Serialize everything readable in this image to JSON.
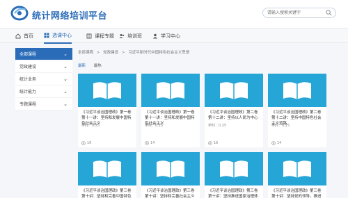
{
  "header": {
    "site_title": "统计网络培训平台",
    "search_placeholder": "请输入搜索关键字"
  },
  "nav": {
    "items": [
      {
        "label": "首页",
        "icon": "home-icon",
        "active": false
      },
      {
        "label": "选课中心",
        "icon": "grid-icon",
        "active": true
      },
      {
        "label": "课程专题",
        "icon": "book-icon",
        "active": false
      },
      {
        "label": "培训班",
        "icon": "users-icon",
        "active": false
      },
      {
        "label": "学习中心",
        "icon": "user-icon",
        "active": false
      }
    ]
  },
  "sidebar": {
    "items": [
      {
        "label": "全部课程",
        "active": true
      },
      {
        "label": "党政建设",
        "active": false
      },
      {
        "label": "统计业务",
        "active": false
      },
      {
        "label": "统计能力",
        "active": false
      },
      {
        "label": "专题课程",
        "active": false
      }
    ]
  },
  "breadcrumb": [
    "全部课程",
    ">",
    "党政建设",
    ">",
    "习近平新时代中国特色社会主义思想"
  ],
  "tabs": [
    {
      "label": "最新",
      "active": true
    },
    {
      "label": "最热",
      "active": false
    }
  ],
  "courses": [
    {
      "title": "《习近平谈治国理政》第一卷 第十一讲：坚持和发展中国特色社会主义",
      "meta": "学时：0.25",
      "views": "16"
    },
    {
      "title": "《习近平谈治国理政》第一卷 第十一讲：坚持和发展中国特色社会主义",
      "meta": "学时：0.25",
      "views": "14"
    },
    {
      "title": "《习近平谈治国理政》第二卷 第十二讲：坚持以人民为中心",
      "meta": "学时：0.25",
      "views": "16"
    },
    {
      "title": "《习近平谈治国理政》第二卷 第十二讲：坚持中国特色社会主义道路",
      "meta": "学时：0.25",
      "views": "14"
    },
    {
      "title": "《习近平谈治国理政》第三卷 第十讲：坚持和完善中国特色社会主义制度",
      "meta": "",
      "views": ""
    },
    {
      "title": "《习近平谈治国理政》第三卷 第十讲：坚持和完善社会主义市场经济",
      "meta": "",
      "views": ""
    },
    {
      "title": "《习近平谈治国理政》第三卷 第十讲：坚持推进国家治理体系",
      "meta": "",
      "views": ""
    },
    {
      "title": "《习近平谈治国理政》第三卷 第十讲：坚持党的领导，推进依法治国",
      "meta": "",
      "views": ""
    }
  ]
}
